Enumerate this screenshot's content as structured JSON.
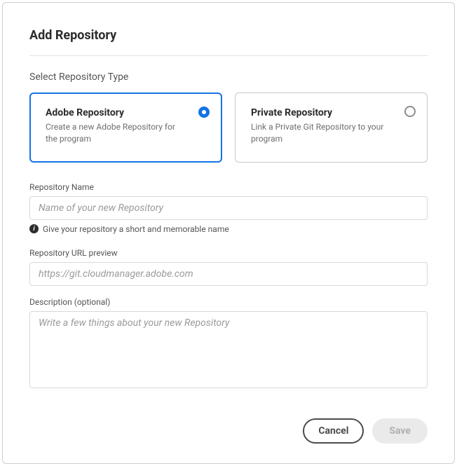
{
  "dialog": {
    "title": "Add Repository"
  },
  "typeSection": {
    "label": "Select Repository Type",
    "options": [
      {
        "title": "Adobe Repository",
        "description": "Create a new Adobe Repository for the program",
        "selected": true
      },
      {
        "title": "Private Repository",
        "description": "Link a Private Git Repository to your program",
        "selected": false
      }
    ]
  },
  "fields": {
    "name": {
      "label": "Repository Name",
      "placeholder": "Name of your new Repository",
      "helper": "Give your repository a short and memorable name"
    },
    "url": {
      "label": "Repository URL preview",
      "value": "https://git.cloudmanager.adobe.com"
    },
    "description": {
      "label": "Description (optional)",
      "placeholder": "Write a few things about your new Repository"
    }
  },
  "footer": {
    "cancel": "Cancel",
    "save": "Save"
  }
}
